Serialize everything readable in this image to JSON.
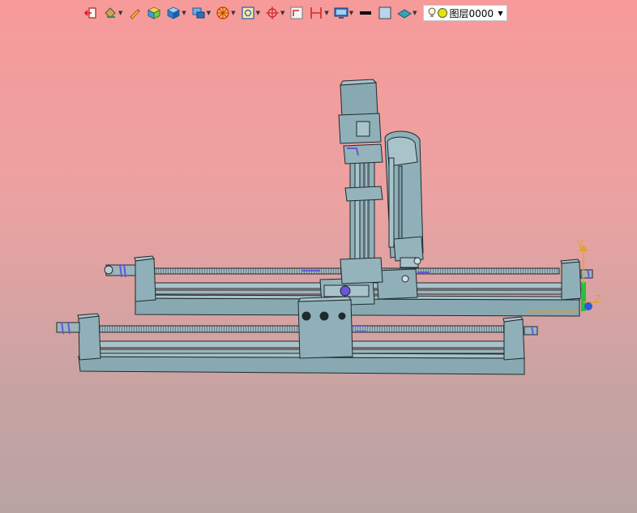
{
  "toolbar": {
    "items": [
      {
        "name": "exit-icon",
        "dropdown": false
      },
      {
        "name": "paint-bucket-icon",
        "dropdown": true
      },
      {
        "name": "pencil-icon",
        "dropdown": false
      },
      {
        "name": "shaded-cube-icon",
        "dropdown": false
      },
      {
        "name": "cube-view-icon",
        "dropdown": true
      },
      {
        "name": "display-mode-icon",
        "dropdown": true
      },
      {
        "name": "section-wheel-icon",
        "dropdown": true
      },
      {
        "name": "zoom-fit-icon",
        "dropdown": true
      },
      {
        "name": "crosshair-icon",
        "dropdown": true
      },
      {
        "name": "frame-icon",
        "dropdown": false
      },
      {
        "name": "dimension-icon",
        "dropdown": true
      },
      {
        "name": "monitor-icon",
        "dropdown": true
      },
      {
        "name": "line-color-icon",
        "dropdown": false
      },
      {
        "name": "fill-color-icon",
        "dropdown": false
      },
      {
        "name": "plane-icon",
        "dropdown": true
      }
    ],
    "layer": {
      "value": "图层0000"
    }
  },
  "triad": {
    "y_label": "Y",
    "z_label": "Z"
  },
  "colors": {
    "part_fill": "#8fb0b9",
    "part_edge": "#1f2a2e",
    "thread": "#5d6a6e",
    "highlight": "#6a56d6",
    "accent_orange": "#e2a12f",
    "triad_green": "#27c23a"
  }
}
